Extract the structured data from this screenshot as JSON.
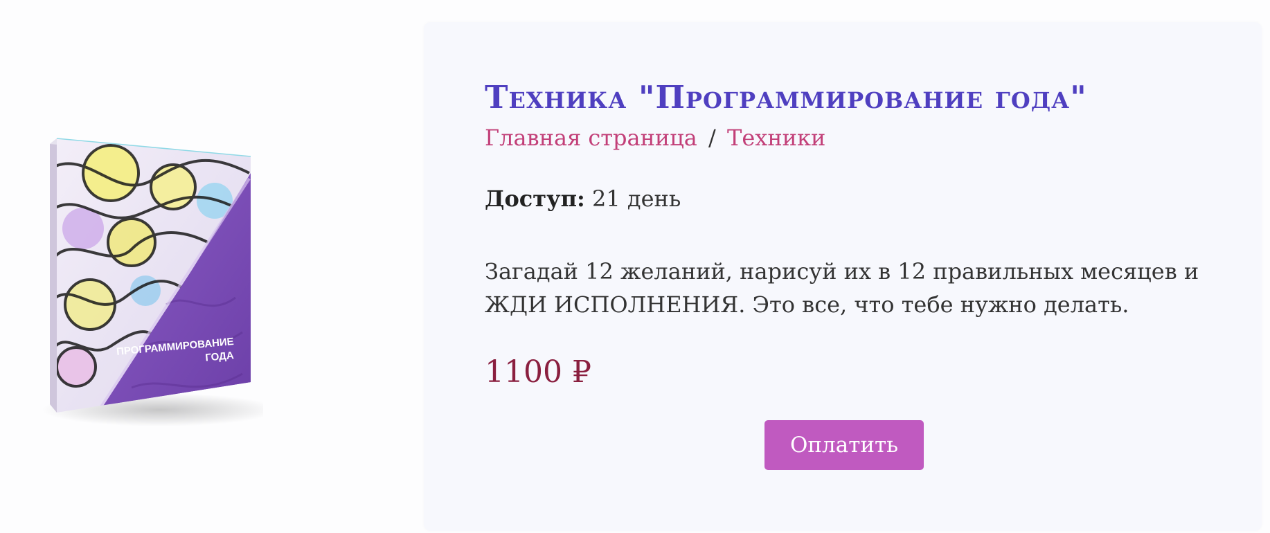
{
  "product": {
    "box_label_line1": "ПРОГРАММИРОВАНИЕ",
    "box_label_line2": "ГОДА",
    "title": "Техника \"Программирование года\"",
    "breadcrumb": {
      "home": "Главная страница",
      "separator": "/",
      "section": "Техники"
    },
    "access_label": "Доступ:",
    "access_value": "21 день",
    "description": "Загадай 12 желаний, нарисуй их в 12 правильных месяцев и ЖДИ ИСПОЛНЕНИЯ. Это все, что тебе нужно делать.",
    "price": "1100 ₽",
    "pay_button_label": "Оплатить"
  },
  "colors": {
    "title": "#4f3fc0",
    "breadcrumb_link": "#c23f78",
    "price": "#8a1f3f",
    "pay_button": "#c05ac0",
    "card_background": "#f7f8fd",
    "box_purple": "#7a4ab5"
  }
}
